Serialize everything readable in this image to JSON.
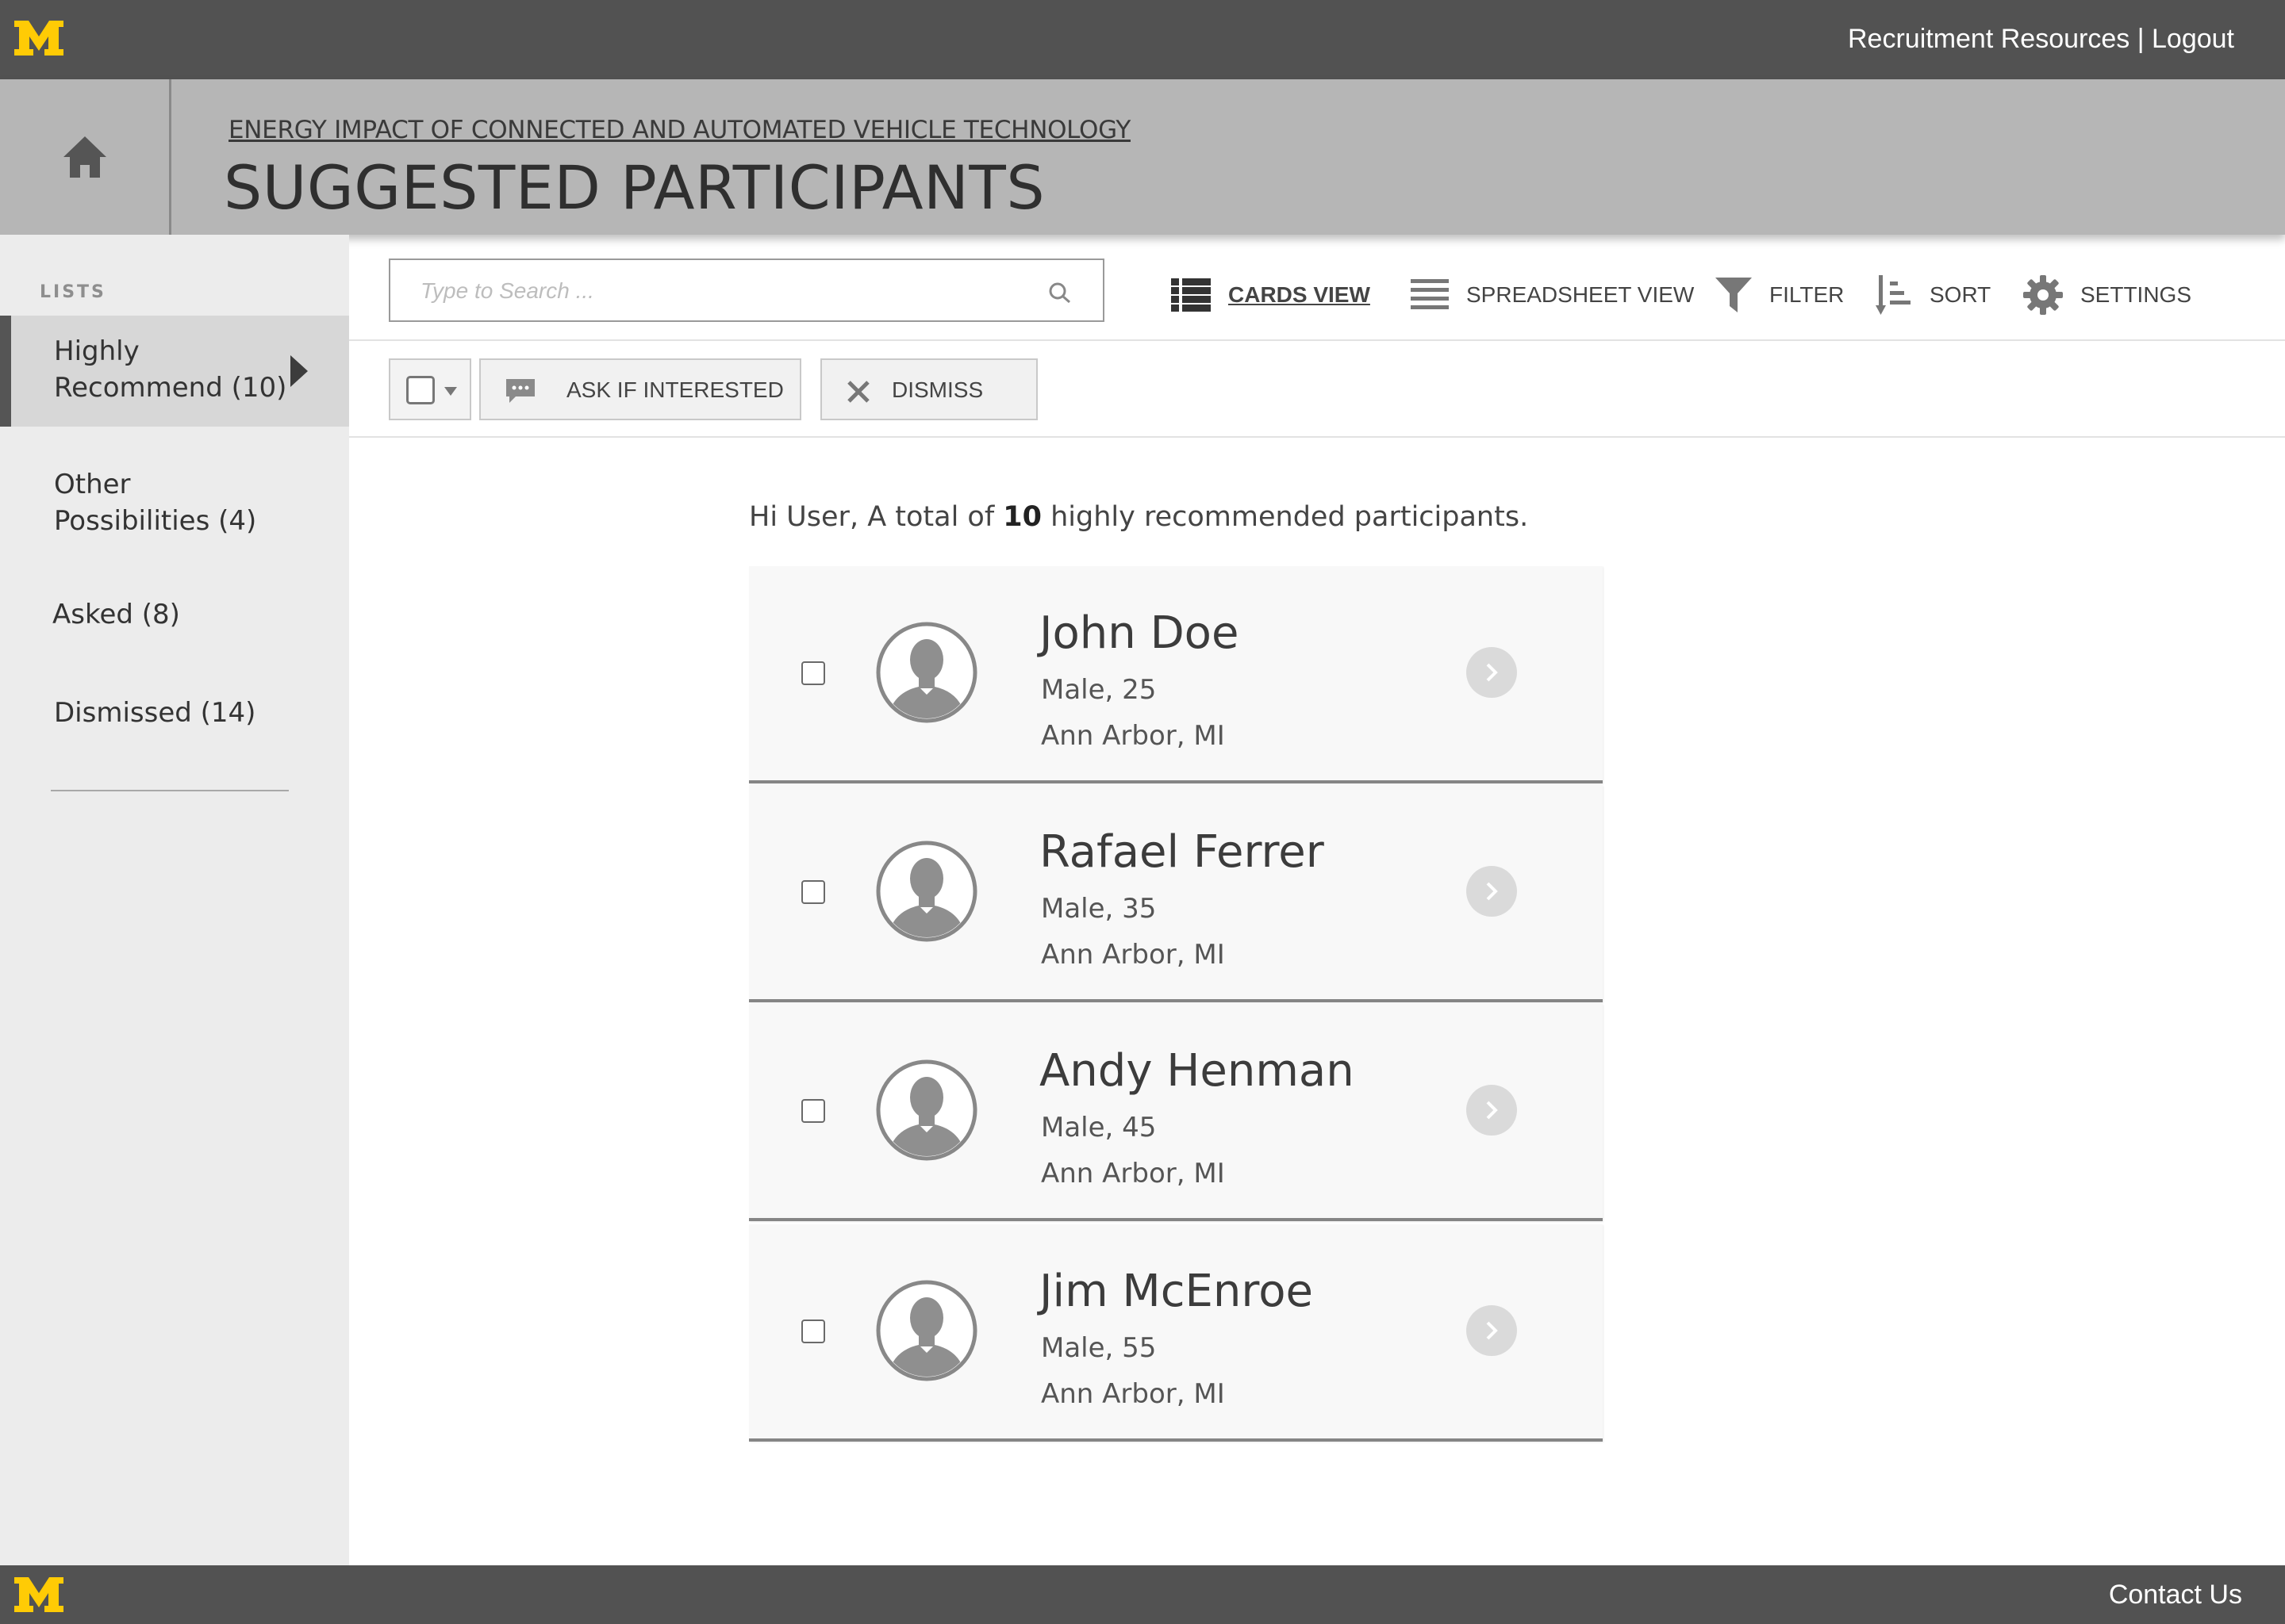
{
  "brand": {
    "logo_letter": "M",
    "logo_color": "#FFCB05"
  },
  "topbar": {
    "resources_link": "Recruitment Resources",
    "separator": "|",
    "logout_link": "Logout"
  },
  "header": {
    "project_link": "ENERGY IMPACT OF CONNECTED AND AUTOMATED VEHICLE TECHNOLOGY",
    "page_title": "SUGGESTED PARTICIPANTS"
  },
  "sidebar": {
    "section_label": "LISTS",
    "items": [
      {
        "line1": "Highly",
        "line2": "Recommend (10)",
        "active": true
      },
      {
        "line1": "Other",
        "line2": "Possibilities (4)",
        "active": false
      },
      {
        "line1": "Asked (8)",
        "line2": "",
        "active": false
      },
      {
        "line1": "Dismissed (14)",
        "line2": "",
        "active": false
      }
    ]
  },
  "toolbar": {
    "search_placeholder": "Type to Search ...",
    "cards_view": "CARDS VIEW",
    "spreadsheet_view": "SPREADSHEET VIEW",
    "filter": "FILTER",
    "sort": "SORT",
    "settings": "SETTINGS"
  },
  "actions": {
    "ask": "ASK IF INTERESTED",
    "dismiss": "DISMISS"
  },
  "main": {
    "greeting_prefix": "Hi User, A total of ",
    "greeting_count": "10",
    "greeting_suffix": " highly recommended participants.",
    "participants": [
      {
        "name": "John Doe",
        "details": "Male, 25",
        "location": "Ann Arbor, MI"
      },
      {
        "name": "Rafael Ferrer",
        "details": "Male, 35",
        "location": "Ann Arbor, MI"
      },
      {
        "name": "Andy Henman",
        "details": "Male, 45",
        "location": "Ann Arbor, MI"
      },
      {
        "name": "Jim McEnroe",
        "details": "Male, 55",
        "location": "Ann Arbor, MI"
      }
    ]
  },
  "footer": {
    "contact_link": "Contact Us"
  }
}
